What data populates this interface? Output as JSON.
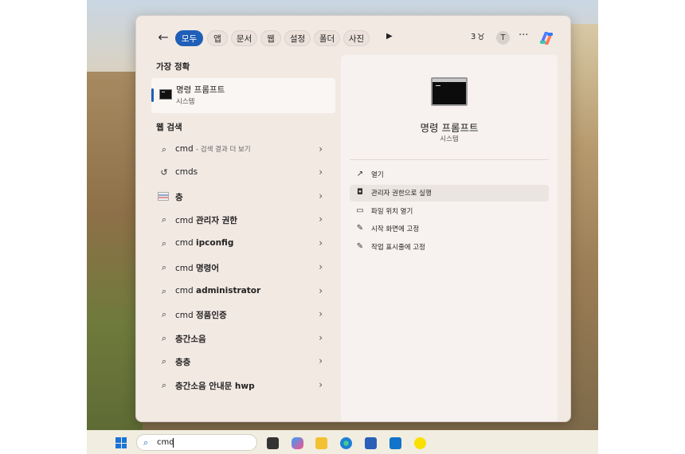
{
  "header": {
    "tabs": [
      {
        "label": "모두",
        "active": true
      },
      {
        "label": "앱"
      },
      {
        "label": "문서"
      },
      {
        "label": "웹"
      },
      {
        "label": "설정"
      },
      {
        "label": "폴더"
      },
      {
        "label": "사진"
      }
    ],
    "points": "3",
    "avatar_letter": "T",
    "more": "···"
  },
  "best_match": {
    "heading": "가장 정확",
    "title": "명령 프롬프트",
    "subtitle": "시스템"
  },
  "web_search": {
    "heading": "웹 검색",
    "items": [
      {
        "prefix": "cmd",
        "bold": "",
        "sub": "- 검색 결과 더 보기",
        "icon": "search-icon"
      },
      {
        "prefix": "cmds",
        "bold": "",
        "sub": "",
        "icon": "history-icon"
      },
      {
        "prefix": "",
        "bold": "층",
        "sub": "",
        "icon": "flag-icon"
      },
      {
        "prefix": "cmd ",
        "bold": "관리자 권한",
        "sub": "",
        "icon": "search-icon"
      },
      {
        "prefix": "cmd ",
        "bold": "ipconfig",
        "sub": "",
        "icon": "search-icon"
      },
      {
        "prefix": "cmd ",
        "bold": "명령어",
        "sub": "",
        "icon": "search-icon"
      },
      {
        "prefix": "cmd ",
        "bold": "administrator",
        "sub": "",
        "icon": "search-icon"
      },
      {
        "prefix": "cmd ",
        "bold": "정품인증",
        "sub": "",
        "icon": "search-icon"
      },
      {
        "prefix": "",
        "bold": "층간소음",
        "sub": "",
        "icon": "search-icon"
      },
      {
        "prefix": "",
        "bold": "층층",
        "sub": "",
        "icon": "search-icon"
      },
      {
        "prefix": "",
        "bold": "층간소음 안내문 hwp",
        "sub": "",
        "icon": "search-icon"
      }
    ]
  },
  "detail": {
    "title": "명령 프롬프트",
    "subtitle": "시스템",
    "actions": [
      {
        "label": "열기",
        "icon": "open-external-icon"
      },
      {
        "label": "관리자 권한으로 실행",
        "icon": "shield-icon"
      },
      {
        "label": "파일 위치 열기",
        "icon": "folder-icon"
      },
      {
        "label": "시작 화면에 고정",
        "icon": "pin-icon"
      },
      {
        "label": "작업 표시줄에 고정",
        "icon": "pin-icon"
      }
    ]
  },
  "taskbar": {
    "search_value": "cmd"
  },
  "colors": {
    "accent": "#1f5fb8",
    "panel": "#f2e9e3"
  }
}
